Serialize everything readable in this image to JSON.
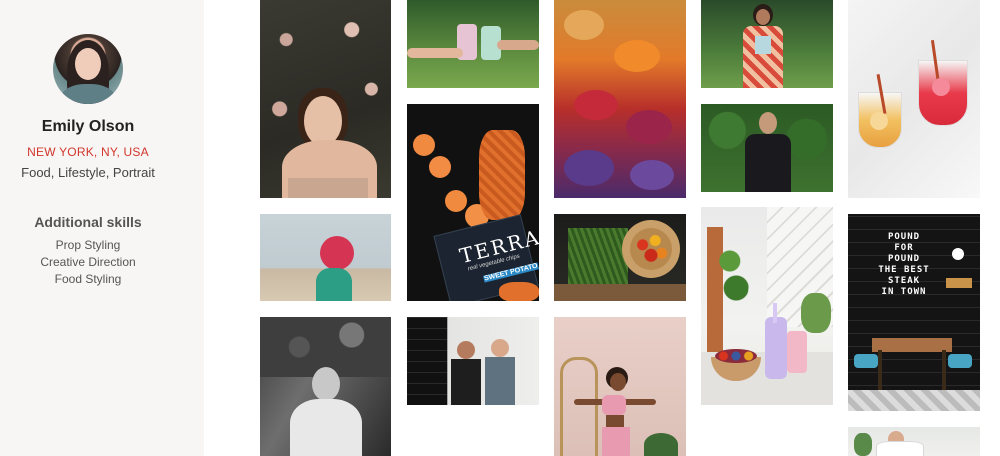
{
  "profile": {
    "name": "Emily Olson",
    "location": "NEW YORK, NY, USA",
    "specialties": "Food, Lifestyle, Portrait",
    "skills_title": "Additional skills",
    "skills": [
      "Prop Styling",
      "Creative Direction",
      "Food Styling"
    ]
  },
  "photos": {
    "terra_bag": {
      "brand": "TERRA",
      "tagline": "real vegetable chips",
      "flavor": "SWEET POTATO"
    },
    "sign": {
      "lines": [
        "POUND",
        "FOR",
        "POUND",
        "THE BEST",
        "STEAK",
        "IN TOWN"
      ]
    }
  },
  "colors": {
    "location": "#d1352b",
    "sidebar_bg": "#f8f6f5"
  }
}
